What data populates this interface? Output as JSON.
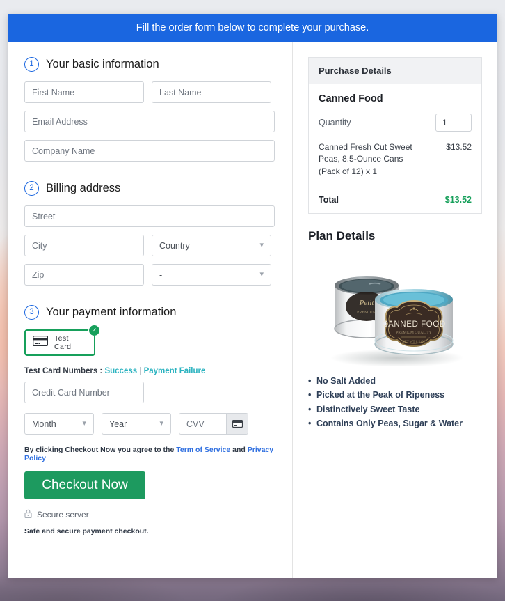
{
  "banner": {
    "text": "Fill the order form below to complete your purchase."
  },
  "basic": {
    "number": "1",
    "title": "Your basic information",
    "first_name_placeholder": "First Name",
    "last_name_placeholder": "Last Name",
    "email_placeholder": "Email Address",
    "company_placeholder": "Company Name"
  },
  "billing": {
    "number": "2",
    "title": "Billing address",
    "street_placeholder": "Street",
    "city_placeholder": "City",
    "country_value": "Country",
    "zip_placeholder": "Zip",
    "region_value": "-"
  },
  "payment": {
    "number": "3",
    "title": "Your payment information",
    "card_option_label": "Test Card",
    "card_selected_badge": "check-icon",
    "test_numbers_label": "Test Card Numbers :",
    "test_success_link": "Success",
    "test_separator": "|",
    "test_failure_link": "Payment Failure",
    "card_number_placeholder": "Credit Card Number",
    "month_value": "Month",
    "year_value": "Year",
    "cvv_placeholder": "CVV",
    "terms_prefix": "By clicking Checkout Now you agree to the",
    "terms_link_1": "Term of Service",
    "terms_and": "and",
    "terms_link_2": "Privacy Policy",
    "checkout_label": "Checkout Now",
    "secure_label": "Secure server",
    "safe_label": "Safe and secure payment checkout."
  },
  "purchase": {
    "header": "Purchase Details",
    "product": "Canned Food",
    "quantity_label": "Quantity",
    "quantity_value": "1",
    "line_item": "Canned Fresh Cut Sweet Peas, 8.5-Ounce Cans (Pack of 12) x 1",
    "line_price": "$13.52",
    "total_label": "Total",
    "total_value": "$13.52"
  },
  "plan": {
    "title": "Plan Details",
    "image_alt": "canned-food-product-image",
    "can_label": "CANNED FOOD",
    "bullets": [
      "No Salt Added",
      "Picked at the Peak of Ripeness",
      "Distinctively Sweet Taste",
      "Contains Only Peas, Sugar & Water"
    ]
  },
  "colors": {
    "banner_blue": "#1a66e0",
    "accent_green": "#1d9a5f",
    "total_green": "#17a05b",
    "link_teal": "#2bb3c0",
    "link_blue": "#2f6fe0"
  }
}
